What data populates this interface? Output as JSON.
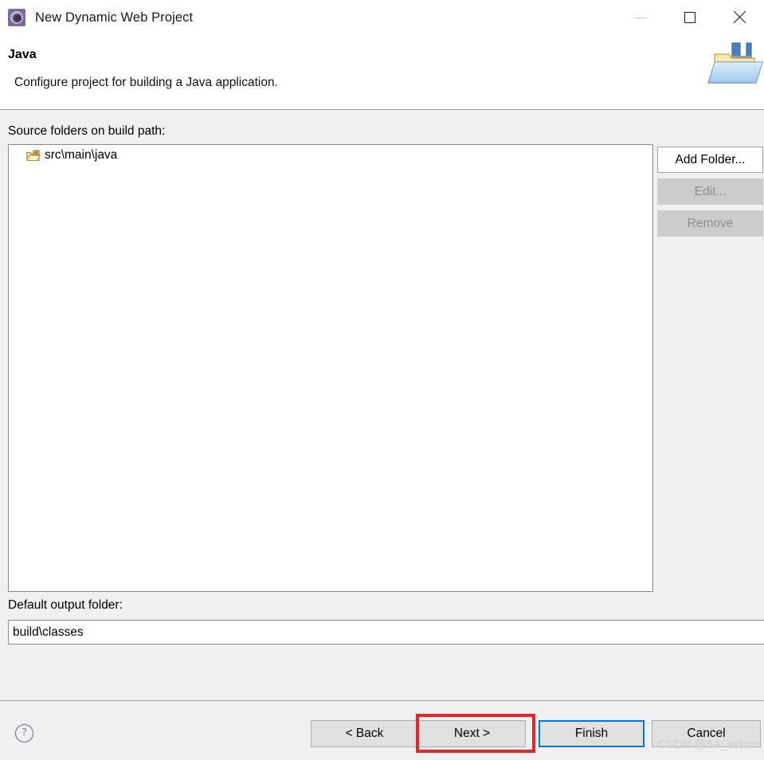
{
  "window": {
    "title": "New Dynamic Web Project",
    "icon": "eclipse-wizard-icon",
    "controls": {
      "minimize": "minimize-icon",
      "maximize": "maximize-icon",
      "close": "close-icon"
    }
  },
  "header": {
    "title": "Java",
    "description": "Configure project for building a Java application.",
    "banner_icon": "java-folder-banner-icon"
  },
  "source_section": {
    "label": "Source folders on build path:",
    "items": [
      {
        "icon": "source-folder-icon",
        "label": "src\\main\\java"
      }
    ],
    "buttons": [
      {
        "label": "Add Folder...",
        "enabled": true
      },
      {
        "label": "Edit...",
        "enabled": false
      },
      {
        "label": "Remove",
        "enabled": false
      }
    ]
  },
  "output_section": {
    "label": "Default output folder:",
    "value": "build\\classes"
  },
  "footer": {
    "help_glyph": "?",
    "buttons": {
      "back": "< Back",
      "next": "Next >",
      "finish": "Finish",
      "cancel": "Cancel"
    },
    "highlight_color": "#e8242b",
    "default_button_color": "#0078d7"
  },
  "watermark": "CSDN @SA_sehun"
}
